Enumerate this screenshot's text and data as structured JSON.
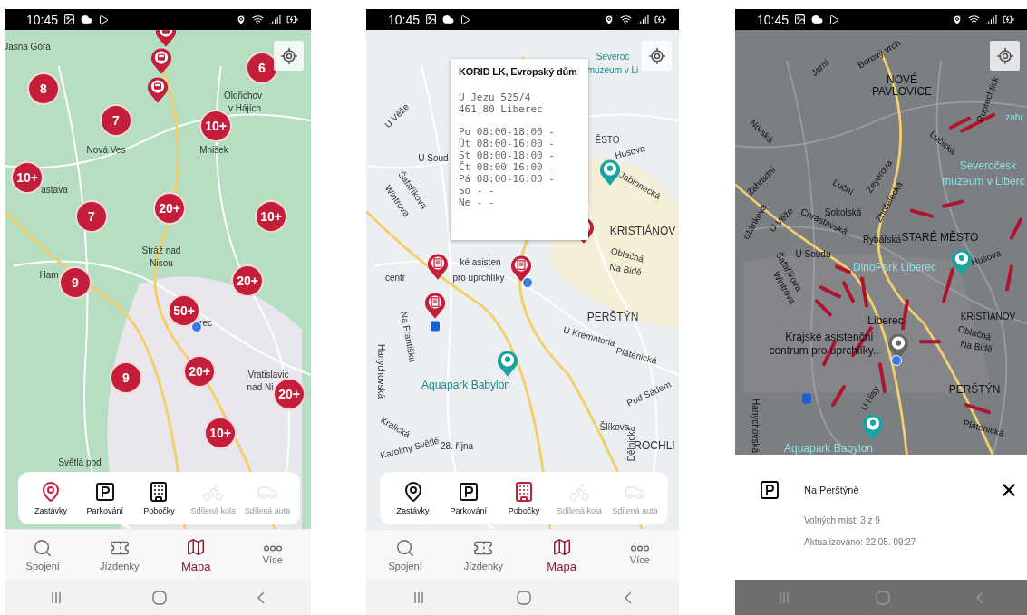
{
  "phones": [
    {
      "status_bar": {
        "time": "10:45"
      },
      "map": {
        "kind": "terrain",
        "labels": [
          "Jasna Góra",
          "Oldřichov",
          "v Hájích",
          "Nová Ves",
          "Mnišek",
          "astava",
          "Stráž nad",
          "Nisou",
          "Ham",
          "rec",
          "Vratislavic",
          "nad Ni",
          "Světlá pod"
        ],
        "markers": [
          {
            "kind": "stop"
          },
          {
            "kind": "stop"
          },
          {
            "kind": "stop"
          },
          {
            "kind": "cluster",
            "count": "6"
          },
          {
            "kind": "cluster",
            "count": "8"
          },
          {
            "kind": "cluster",
            "count": "7"
          },
          {
            "kind": "cluster",
            "count": "10+"
          },
          {
            "kind": "cluster",
            "count": "10+"
          },
          {
            "kind": "cluster",
            "count": "20+"
          },
          {
            "kind": "cluster",
            "count": "7"
          },
          {
            "kind": "cluster",
            "count": "10+"
          },
          {
            "kind": "cluster",
            "count": "9"
          },
          {
            "kind": "cluster",
            "count": "20+"
          },
          {
            "kind": "cluster",
            "count": "50+"
          },
          {
            "kind": "cluster",
            "count": "20+"
          },
          {
            "kind": "cluster",
            "count": "9"
          },
          {
            "kind": "cluster",
            "count": "20+"
          },
          {
            "kind": "cluster",
            "count": "10+"
          },
          {
            "kind": "user"
          }
        ]
      },
      "category_bar": {
        "items": [
          {
            "kind": "stops",
            "label": "Zastávky",
            "selected": true,
            "disabled": false
          },
          {
            "kind": "parking",
            "label": "Parkování",
            "selected": false,
            "disabled": false
          },
          {
            "kind": "branches",
            "label": "Pobočky",
            "selected": false,
            "disabled": false
          },
          {
            "kind": "bikes",
            "label": "Sdílená kola",
            "selected": false,
            "disabled": true
          },
          {
            "kind": "cars",
            "label": "Sdílená auta",
            "selected": false,
            "disabled": true
          }
        ]
      },
      "tabs": [
        {
          "kind": "search",
          "label": "Spojení",
          "selected": false
        },
        {
          "kind": "tickets",
          "label": "Jízdenky",
          "selected": false
        },
        {
          "kind": "map",
          "label": "Mapa",
          "selected": true
        },
        {
          "kind": "more",
          "label": "Více",
          "selected": false
        }
      ]
    },
    {
      "status_bar": {
        "time": "10:45"
      },
      "map": {
        "kind": "streets",
        "labels": [
          "Severoč",
          "muzeum v Li",
          "U Věže",
          "U Soud",
          "Šafaříkova",
          "Wintrova",
          "ĚSTO",
          "Husova",
          "Jablonecká",
          "KRISTIÁNOV",
          "Oblačná",
          "Na Bidě",
          "ké asisten",
          "centr",
          "pro uprchlíky",
          "PERŠTÝN",
          "U Krematoria",
          "Plátenická",
          "Na Františku",
          "Hanychovská",
          "Aquapark Babylon",
          "Pod Sádem",
          "Šlíkova",
          "Dělnická",
          "ROCHLI",
          "Kralická",
          "Karoliny Světlé",
          "28. října"
        ],
        "markers": [
          {
            "kind": "branch"
          },
          {
            "kind": "branch"
          },
          {
            "kind": "branch"
          },
          {
            "kind": "branch"
          },
          {
            "kind": "poi"
          },
          {
            "kind": "poi"
          },
          {
            "kind": "user"
          },
          {
            "kind": "station"
          }
        ]
      },
      "popup": {
        "title": "KORID LK, Evropský dům",
        "address_lines": [
          "U Jezu 525/4",
          "461 80 Liberec"
        ],
        "hours": [
          "Po 08:00-18:00 -",
          "Út 08:00-16:00 -",
          "St 08:00-18:00 -",
          "Čt 08:00-16:00 -",
          "Pá 08:00-16:00 -",
          "So - -",
          "Ne - -"
        ]
      },
      "category_bar": {
        "items": [
          {
            "kind": "stops",
            "label": "Zastávky",
            "selected": false,
            "disabled": false
          },
          {
            "kind": "parking",
            "label": "Parkování",
            "selected": false,
            "disabled": false
          },
          {
            "kind": "branches",
            "label": "Pobočky",
            "selected": true,
            "disabled": false
          },
          {
            "kind": "bikes",
            "label": "Sdílená kola",
            "selected": false,
            "disabled": true
          },
          {
            "kind": "cars",
            "label": "Sdílená auta",
            "selected": false,
            "disabled": true
          }
        ]
      },
      "tabs": [
        {
          "kind": "search",
          "label": "Spojení",
          "selected": false
        },
        {
          "kind": "tickets",
          "label": "Jízdenky",
          "selected": false
        },
        {
          "kind": "map",
          "label": "Mapa",
          "selected": true
        },
        {
          "kind": "more",
          "label": "Více",
          "selected": false
        }
      ]
    },
    {
      "status_bar": {
        "time": "10:45"
      },
      "map": {
        "kind": "dimmed",
        "labels": [
          "Jarní",
          "Borový vrch",
          "NOVÉ",
          "PAVLOVICE",
          "Norská",
          "Ruprechtick",
          "zahr",
          "Lučická",
          "Zahradní",
          "Zeyerova",
          "Zhořelecká",
          "Luční",
          "Severočesk",
          "muzeum v Liberc",
          "Sokolská",
          "Chrastavská",
          "U Věže",
          "ožánkova",
          "Rybářská",
          "STARÉ MĚSTO",
          "U Soudu",
          "Šafaříkova",
          "Wintrova",
          "DinoPark Liberec",
          "Husova",
          "Liberec",
          "KRISTIÁNOV",
          "Oblačná",
          "Na Bidě",
          "Krajské asistenční",
          "centrum pro uprchlíky..",
          "PERŠTÝN",
          "U Nisy",
          "Plátenická",
          "Hanychovská",
          "Aquapark Babylon"
        ],
        "markers": [
          {
            "kind": "place"
          },
          {
            "kind": "user"
          },
          {
            "kind": "poi"
          },
          {
            "kind": "poi"
          },
          {
            "kind": "station"
          }
        ]
      },
      "sheet": {
        "title": "Na Perštýně",
        "lines": [
          "Volných míst: 3 z 9",
          "Aktualizováno: 22.05. 09:27"
        ]
      }
    }
  ]
}
